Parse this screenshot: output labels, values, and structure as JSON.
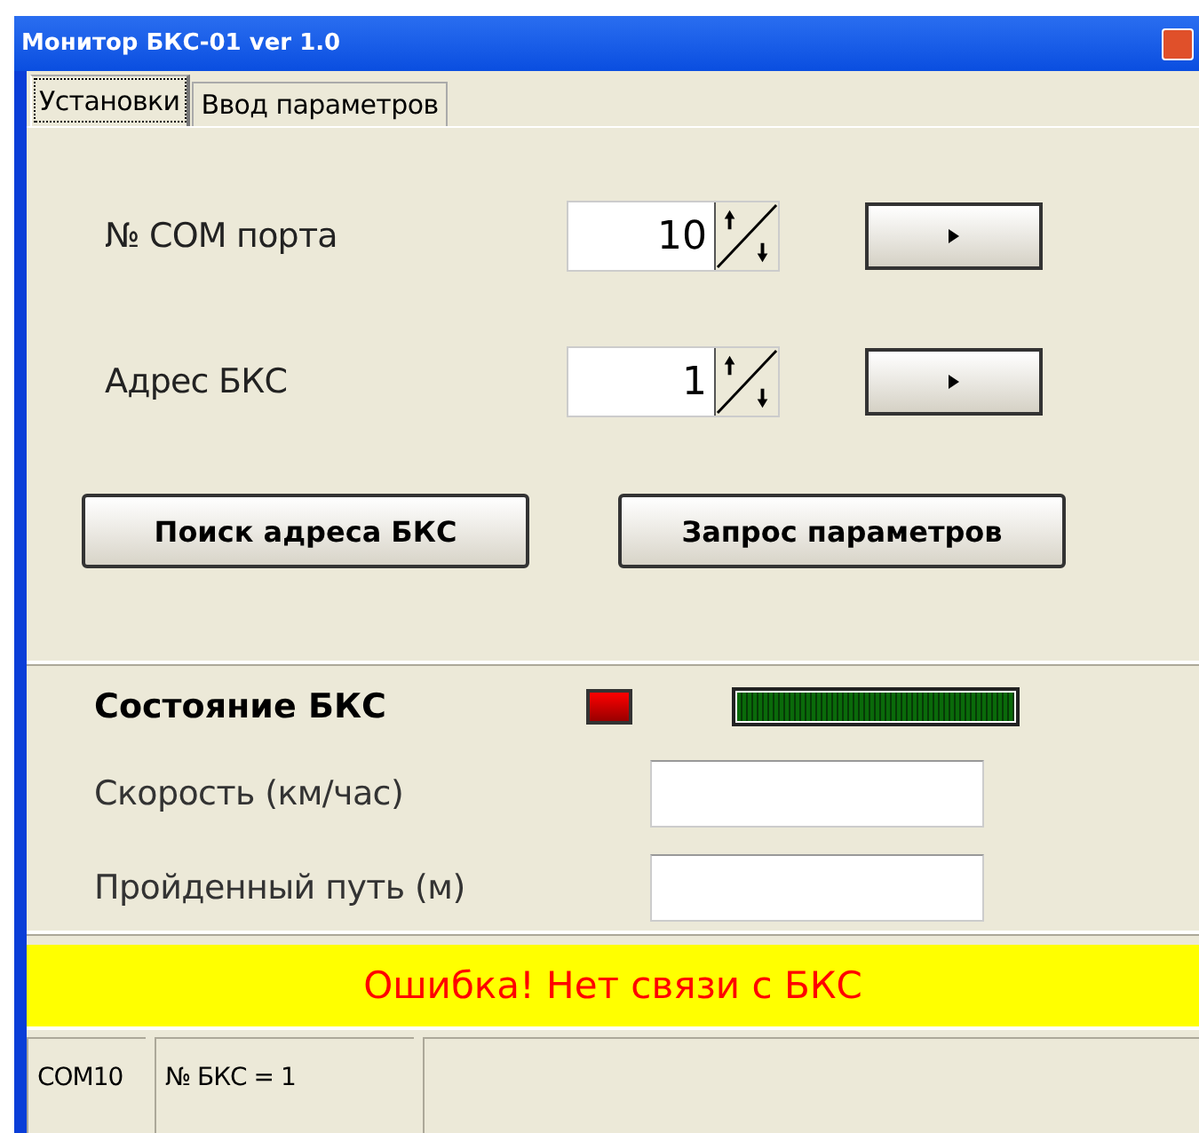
{
  "window": {
    "title": "Монитор БКС-01 ver 1.0"
  },
  "tabs": [
    {
      "label": "Установки",
      "selected": true
    },
    {
      "label": "Ввод параметров",
      "selected": false
    }
  ],
  "settings": [
    {
      "label": "№ COM порта",
      "value": "10"
    },
    {
      "label": "Адрес БКС",
      "value": "1"
    }
  ],
  "buttons": [
    "Поиск адреса БКС",
    "Запрос параметров"
  ],
  "state": {
    "label": "Состояние БКС",
    "connected": false,
    "level": 1
  },
  "readings": [
    {
      "label": "Скорость (км/час)"
    },
    {
      "label": "Пройденный путь (м)"
    }
  ],
  "message": "Ошибка! Нет связи с БКС",
  "status_bar": [
    "COM10",
    "№ БКС = 1"
  ]
}
